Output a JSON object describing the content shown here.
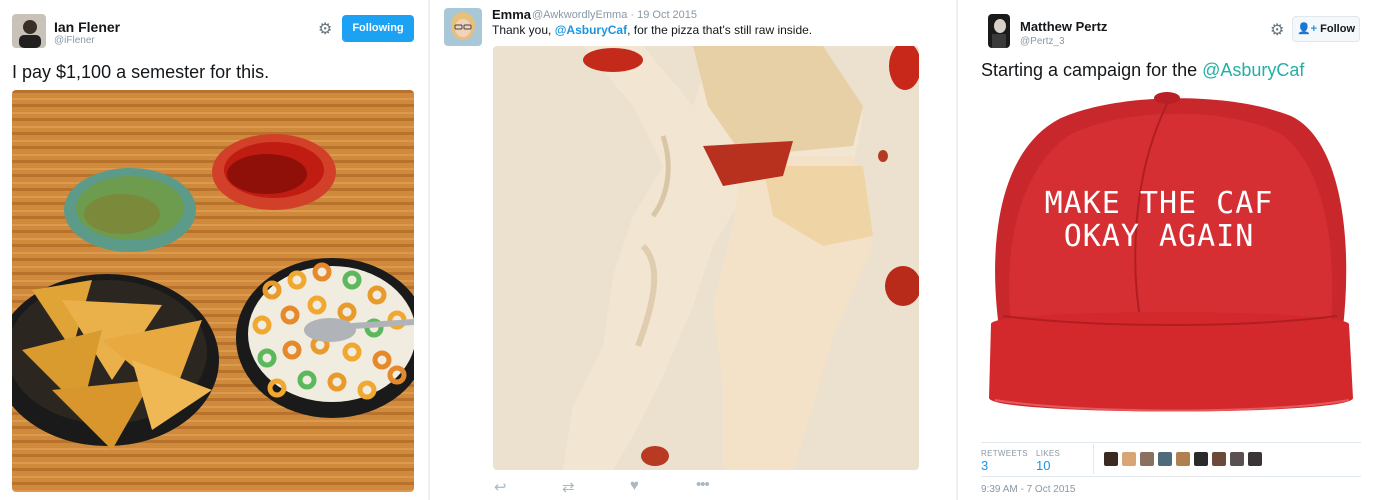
{
  "tweets": [
    {
      "name": "Ian Flener",
      "handle": "@iFlener",
      "button_label": "Following",
      "text": "I pay $1,100 a semester for this."
    },
    {
      "name": "Emma",
      "handle_date": "@AwkwordlyEmma · 19 Oct 2015",
      "text_before": "Thank you, ",
      "mention": "@AsburyCaf",
      "text_after": ", for the pizza that's still raw inside."
    },
    {
      "name": "Matthew Pertz",
      "handle": "@Pertz_3",
      "button_label": "Follow",
      "text_before": "Starting a campaign for the ",
      "mention": "@AsburyCaf",
      "hat_line1": "MAKE THE CAF",
      "hat_line2": "OKAY AGAIN",
      "retweets_label": "RETWEETS",
      "retweets": "3",
      "likes_label": "LIKES",
      "likes": "10",
      "timestamp": "9:39 AM - 7 Oct 2015"
    }
  ],
  "colors": {
    "accent": "#1b95e0",
    "following_bg": "#1da1f2",
    "hat_red": "#d12a2e"
  },
  "icons": [
    "gear-icon",
    "follow-person-icon",
    "reply-icon",
    "retweet-icon",
    "like-icon",
    "more-icon"
  ]
}
